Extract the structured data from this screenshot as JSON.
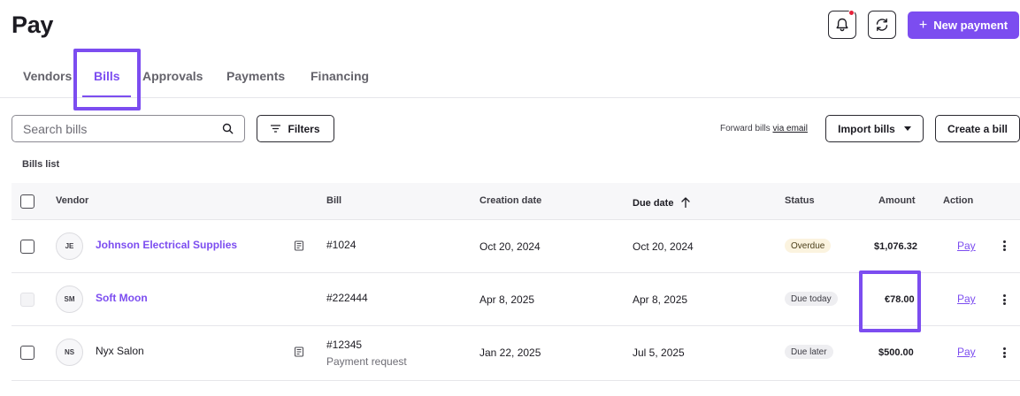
{
  "header": {
    "title": "Pay",
    "new_payment_label": "New payment",
    "has_notification": true
  },
  "tabs": [
    {
      "label": "Vendors",
      "active": false
    },
    {
      "label": "Bills",
      "active": true
    },
    {
      "label": "Approvals",
      "active": false
    },
    {
      "label": "Payments",
      "active": false
    },
    {
      "label": "Financing",
      "active": false
    }
  ],
  "toolbar": {
    "search_placeholder": "Search bills",
    "filters_label": "Filters",
    "forward_text": "Forward bills",
    "forward_link": "via email",
    "import_label": "Import bills",
    "create_label": "Create a bill"
  },
  "list_label": "Bills list",
  "table": {
    "columns": {
      "vendor": "Vendor",
      "bill": "Bill",
      "creation_date": "Creation date",
      "due_date": "Due date",
      "status": "Status",
      "amount": "Amount",
      "action": "Action"
    },
    "sort_column": "due_date",
    "sort_direction": "ascending",
    "rows": [
      {
        "initials": "JE",
        "vendor": "Johnson Electrical Supplies",
        "vendor_linked": true,
        "has_document": true,
        "bill_number": "#1024",
        "bill_subtitle": "",
        "creation_date": "Oct 20, 2024",
        "due_date": "Oct 20, 2024",
        "status": "Overdue",
        "amount": "$1,076.32",
        "action": "Pay",
        "selectable": true
      },
      {
        "initials": "SM",
        "vendor": "Soft Moon",
        "vendor_linked": true,
        "has_document": false,
        "bill_number": "#222444",
        "bill_subtitle": "",
        "creation_date": "Apr 8, 2025",
        "due_date": "Apr 8, 2025",
        "status": "Due today",
        "amount": "€78.00",
        "action": "Pay",
        "selectable": false
      },
      {
        "initials": "NS",
        "vendor": "Nyx Salon",
        "vendor_linked": false,
        "has_document": true,
        "bill_number": "#12345",
        "bill_subtitle": "Payment request",
        "creation_date": "Jan 22, 2025",
        "due_date": "Jul 5, 2025",
        "status": "Due later",
        "amount": "$500.00",
        "action": "Pay",
        "selectable": true
      }
    ]
  },
  "colors": {
    "accent": "#7c4df0",
    "notification": "#e5233b",
    "overdue_badge": "#fbf3df",
    "neutral_badge": "#eeeef1"
  },
  "icons": [
    "bell-icon",
    "refresh-icon",
    "plus-icon",
    "search-icon",
    "filter-icon",
    "caret-down-icon",
    "sort-arrow-up-icon",
    "document-icon",
    "kebab-menu-icon"
  ]
}
